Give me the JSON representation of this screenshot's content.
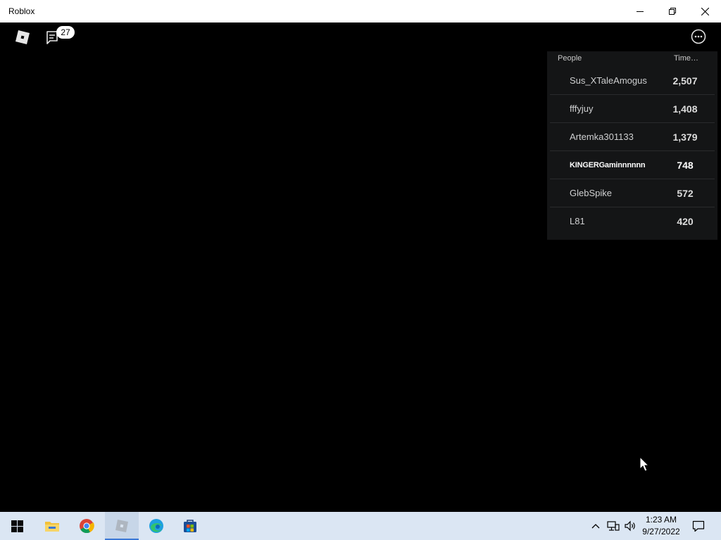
{
  "window": {
    "title": "Roblox"
  },
  "topbar": {
    "chat_badge": "27"
  },
  "leaderboard": {
    "header_people": "People",
    "header_stat": "Time…",
    "rows": [
      {
        "name": "Sus_XTaleAmogus",
        "value": "2,507",
        "highlight": false
      },
      {
        "name": "fffyjuy",
        "value": "1,408",
        "highlight": false
      },
      {
        "name": "Artemka301133",
        "value": "1,379",
        "highlight": false
      },
      {
        "name": "KINGERGaminnnnnn",
        "value": "748",
        "highlight": true
      },
      {
        "name": "GlebSpike",
        "value": "572",
        "highlight": false
      },
      {
        "name": "L81",
        "value": "420",
        "highlight": false
      }
    ]
  },
  "taskbar": {
    "apps": [
      "start-icon",
      "file-explorer-icon",
      "chrome-icon",
      "roblox-icon",
      "edge-icon",
      "store-icon"
    ],
    "active_app": "roblox-icon",
    "time": "1:23 AM",
    "date": "9/27/2022"
  },
  "colors": {
    "taskbar_bg": "#dbe6f3",
    "accent": "#3b78d6"
  }
}
